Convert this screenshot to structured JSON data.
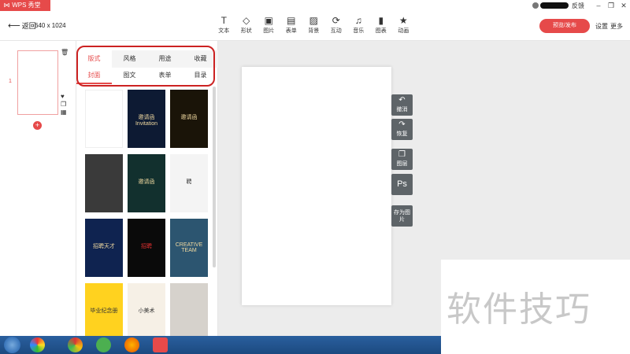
{
  "titlebar": {
    "brand": "WPS 秀堂",
    "feedback": "反馈",
    "window_buttons": [
      "minimize-icon",
      "restore-icon",
      "close-icon"
    ]
  },
  "toolbar": {
    "back_label": "返回",
    "canvas_size": "640 x 1024",
    "tools": [
      {
        "label": "文本",
        "icon": "text-icon",
        "glyph": "T"
      },
      {
        "label": "形状",
        "icon": "shape-icon",
        "glyph": "◇"
      },
      {
        "label": "图片",
        "icon": "image-icon",
        "glyph": "▣"
      },
      {
        "label": "表单",
        "icon": "form-icon",
        "glyph": "▤"
      },
      {
        "label": "背景",
        "icon": "background-icon",
        "glyph": "▨"
      },
      {
        "label": "互动",
        "icon": "interact-icon",
        "glyph": "⟳"
      },
      {
        "label": "音乐",
        "icon": "music-icon",
        "glyph": "♫"
      },
      {
        "label": "图表",
        "icon": "chart-icon",
        "glyph": "▮"
      },
      {
        "label": "动画",
        "icon": "animation-icon",
        "glyph": "★"
      }
    ],
    "publish_label": "预览/发布",
    "settings_label": "设置",
    "more_label": "更多"
  },
  "pages": {
    "current_page": "1"
  },
  "template_panel": {
    "primary_tabs": [
      "版式",
      "风格",
      "用途",
      "收藏"
    ],
    "primary_active": "版式",
    "secondary_tabs": [
      "封面",
      "图文",
      "表单",
      "目录"
    ],
    "secondary_active": "封面",
    "templates": [
      {
        "title": "",
        "colors": "#ffffff"
      },
      {
        "title": "邀请函 Invitation",
        "colors": "#0d1a33"
      },
      {
        "title": "邀请函",
        "colors": "#1a1408"
      },
      {
        "title": "",
        "colors": "#3a3a3a"
      },
      {
        "title": "邀请函",
        "colors": "#12302e"
      },
      {
        "title": "聘",
        "colors": "#f4f4f4"
      },
      {
        "title": "招聘天才",
        "colors": "#0f2350"
      },
      {
        "title": "招聘",
        "colors": "#0a0a0a"
      },
      {
        "title": "CREATIVE TEAM",
        "colors": "#2c5570"
      },
      {
        "title": "毕业纪念册",
        "colors": "#ffd21f"
      },
      {
        "title": "小美术",
        "colors": "#f6f0e6"
      },
      {
        "title": "",
        "colors": "#d6d2cc"
      }
    ]
  },
  "canvas_tools": [
    {
      "label": "撤消",
      "icon": "undo-icon",
      "glyph": "↶"
    },
    {
      "label": "恢复",
      "icon": "redo-icon",
      "glyph": "↷"
    },
    {
      "label": "图层",
      "icon": "layers-icon",
      "glyph": "❐"
    },
    {
      "label": "Ps",
      "icon": "photoshop-icon",
      "glyph": ""
    },
    {
      "label": "存为图片",
      "icon": "save-image-icon",
      "glyph": ""
    }
  ],
  "watermark": "软件技巧"
}
